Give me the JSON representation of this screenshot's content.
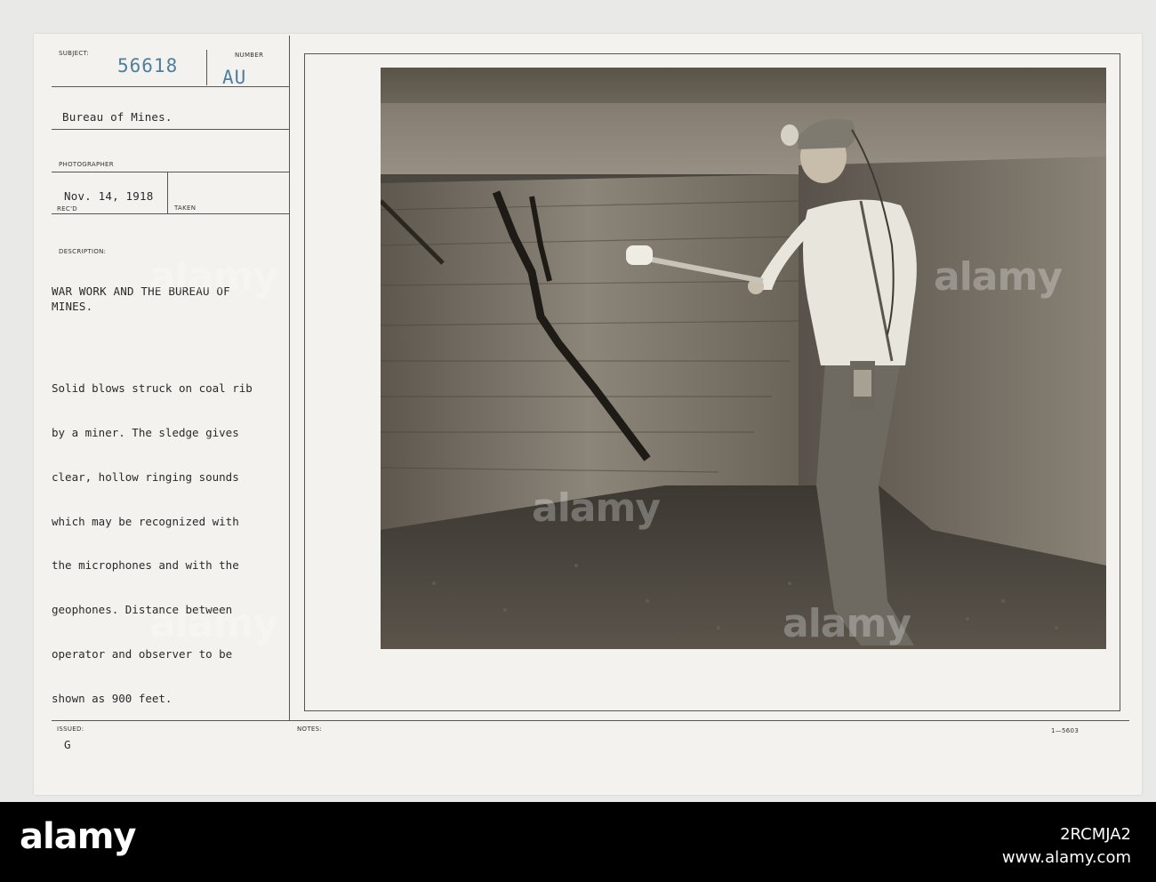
{
  "record": {
    "subject_label": "SUBJECT:",
    "subject_number": "56618",
    "number_label": "NUMBER",
    "number_code": "AU",
    "agency": "Bureau of Mines.",
    "photographer_label": "PHOTOGRAPHER",
    "date": "Nov. 14, 1918",
    "recd_label": "REC'D",
    "taken_label": "TAKEN",
    "description_label": "DESCRIPTION:",
    "title_lines": [
      "WAR WORK AND THE BUREAU OF",
      "MINES."
    ],
    "description_lines": [
      "Solid blows struck on coal rib",
      "by a miner. The sledge gives",
      "clear, hollow ringing sounds",
      "which may be recognized with",
      "the microphones and with the",
      "geophones. Distance between",
      "operator and observer to be",
      "shown as 900 feet."
    ],
    "issued_label": "ISSUED:",
    "issued_value": "G",
    "notes_label": "NOTES:",
    "form_code": "1—5603"
  },
  "watermark": {
    "logo": "alamy",
    "image_id": "2RCMJA2",
    "domain": "www.alamy.com"
  }
}
